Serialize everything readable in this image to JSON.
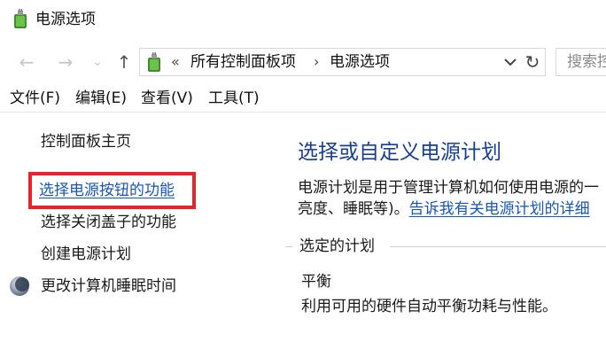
{
  "window": {
    "title": "电源选项"
  },
  "address": {
    "overflow": "«",
    "crumbs": [
      "所有控制面板项",
      "电源选项"
    ],
    "separator": "›",
    "search_placeholder": "搜索控"
  },
  "menu": [
    "文件(F)",
    "编辑(E)",
    "查看(V)",
    "工具(T)"
  ],
  "sidebar": {
    "home": "控制面板主页",
    "links": [
      "选择电源按钮的功能",
      "选择关闭盖子的功能",
      "创建电源计划",
      "更改计算机睡眠时间"
    ]
  },
  "main": {
    "heading": "选择或自定义电源计划",
    "desc_line1": "电源计划是用于管理计算机如何使用电源的一",
    "desc_line2_prefix": "亮度、睡眠等)。",
    "desc_line2_link": "告诉我有关电源计划的详细",
    "section_label": "选定的计划",
    "plan_name": "平衡",
    "plan_desc": "利用可用的硬件自动平衡功耗与性能。"
  },
  "colors": {
    "heading": "#1a3f8f",
    "link": "#1a55b0",
    "highlight": "#e8232b"
  }
}
